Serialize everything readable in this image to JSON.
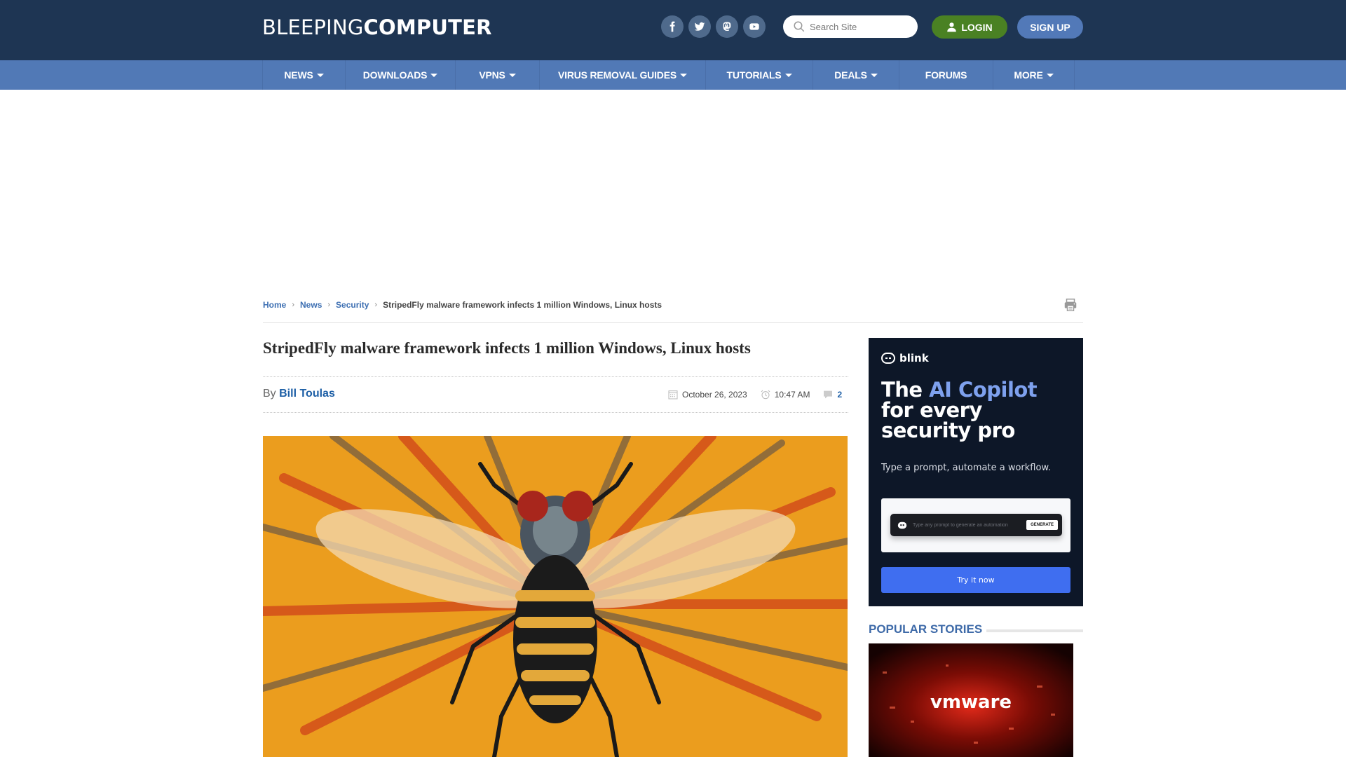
{
  "header": {
    "logo_light": "BLEEPING",
    "logo_bold": "COMPUTER",
    "social": [
      {
        "name": "facebook-icon"
      },
      {
        "name": "twitter-icon"
      },
      {
        "name": "mastodon-icon"
      },
      {
        "name": "youtube-icon"
      }
    ],
    "search_placeholder": "Search Site",
    "login_label": "LOGIN",
    "signup_label": "SIGN UP"
  },
  "nav": {
    "items": [
      {
        "label": "NEWS",
        "dropdown": true
      },
      {
        "label": "DOWNLOADS",
        "dropdown": true
      },
      {
        "label": "VPNS",
        "dropdown": true
      },
      {
        "label": "VIRUS REMOVAL GUIDES",
        "dropdown": true
      },
      {
        "label": "TUTORIALS",
        "dropdown": true
      },
      {
        "label": "DEALS",
        "dropdown": true
      },
      {
        "label": "FORUMS",
        "dropdown": false
      },
      {
        "label": "MORE",
        "dropdown": true
      }
    ]
  },
  "breadcrumb": {
    "items": [
      "Home",
      "News",
      "Security"
    ],
    "current": "StripedFly malware framework infects 1 million Windows, Linux hosts"
  },
  "article": {
    "title": "StripedFly malware framework infects 1 million Windows, Linux hosts",
    "by_prefix": "By",
    "author": "Bill Toulas",
    "date": "October 26, 2023",
    "time": "10:47 AM",
    "comments": "2"
  },
  "ad": {
    "brand": "blink",
    "headline_1": "The ",
    "headline_highlight": "AI Copilot",
    "headline_2": "for every",
    "headline_3": "security pro",
    "subtext": "Type a prompt, automate a workflow.",
    "prompt_placeholder": "Type any prompt to generate an automation",
    "generate_label": "GENERATE",
    "cta_label": "Try it now",
    "colors": {
      "background": "#0d1728",
      "highlight": "#7ea1ee",
      "cta": "#3f6ef0"
    }
  },
  "sidebar": {
    "popular_title": "POPULAR STORIES",
    "popular_image_text": "vmware"
  },
  "colors": {
    "header_bg": "#1e3553",
    "nav_bg": "#5179b6",
    "login_green": "#4a8123",
    "signup_blue": "#5279b8",
    "link_blue": "#1d5fa6"
  }
}
